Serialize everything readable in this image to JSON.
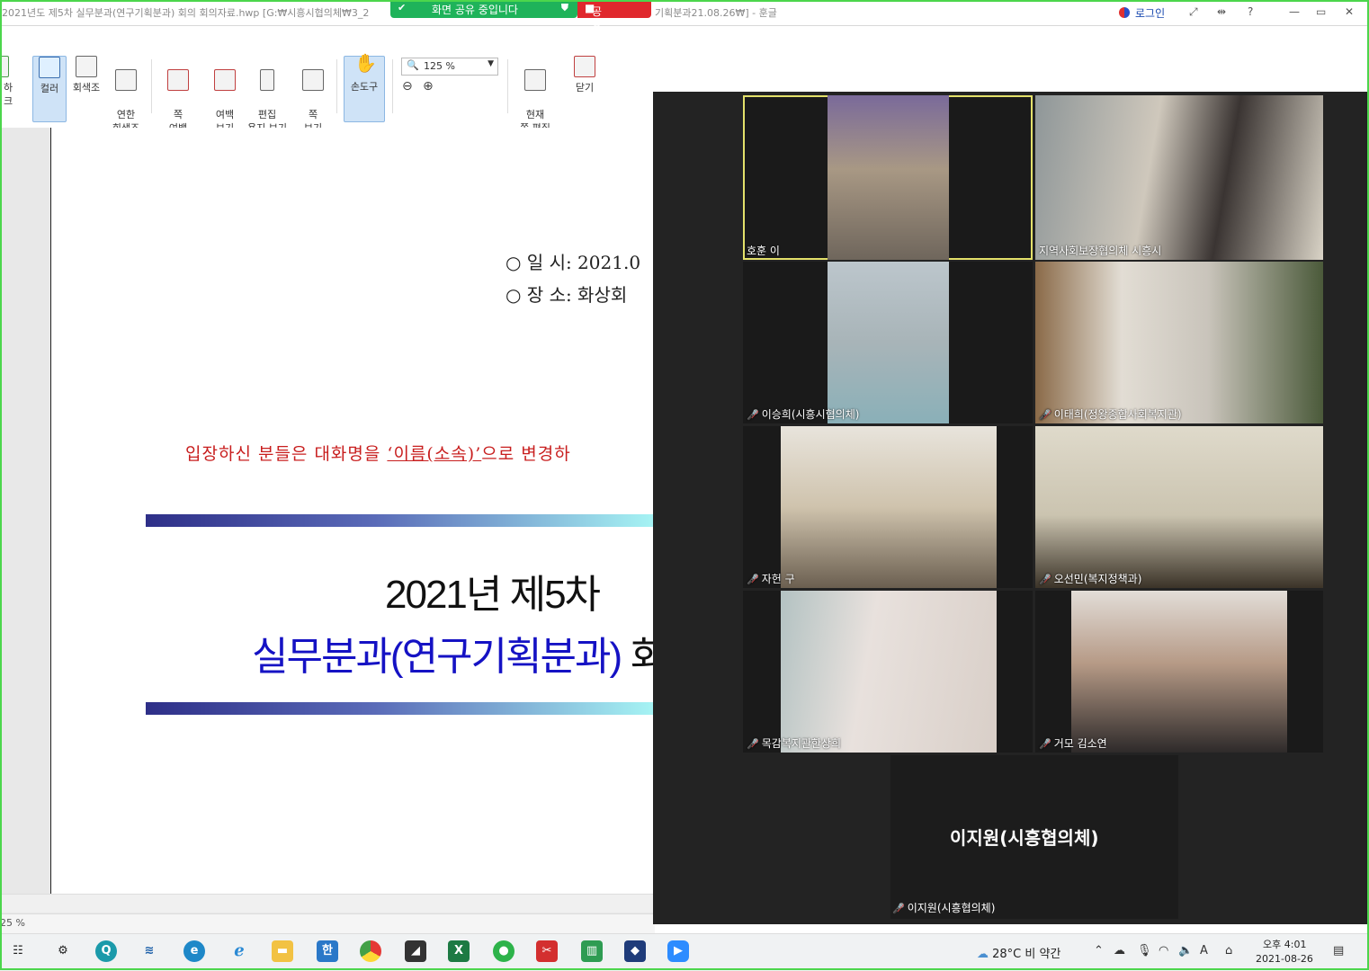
{
  "window": {
    "title": "2021년도 제5차 실무분과(연구기획분과) 회의 회의자료.hwp [G:₩시흥시협의체₩3_2",
    "title_tail": "기획분과21.08.26₩] - 훈글",
    "login_label": "로그인",
    "controls": [
      "⤢",
      "⇹",
      "?",
      "—",
      "▭",
      "✕"
    ]
  },
  "share_bar": {
    "status": "화면 공유 중입니다",
    "stop_label": "공유 중지",
    "color": "#1fb35a",
    "stop_color": "#e0282d"
  },
  "toolbar": {
    "cut_label": "하크",
    "color_label": "컬러",
    "grayscale_label": "회색조",
    "light_gray_label": "연한\n회색조",
    "page_margin_label": "쪽\n여백",
    "margin_view_label": "여백\n보기",
    "edit_paper_label": "편집\n용지 보기",
    "page_view_label": "쪽\n보기",
    "hand_tool_label": "손도구",
    "zoom_value": "125 %",
    "current_page_edit_label": "현재\n쪽 편집",
    "close_label": "닫기"
  },
  "document": {
    "date_line": "○  일  시:  2021.0",
    "place_line": "○  장  소:  화상회",
    "notice_prefix": "입장하신 분들은 대화명을 ",
    "notice_underlined": "‘이름(소속)’",
    "notice_suffix": "으로 변경하",
    "title_line1": "2021년  제5차",
    "title_line2_blue": "실무분과(연구기획분과) ",
    "title_line2_black": "회",
    "zoom_status": "25 %"
  },
  "meeting": {
    "participants": [
      {
        "name": "호훈 이",
        "muted": false,
        "active_speaker": true
      },
      {
        "name": "지역사회보장협의체 시흥시",
        "muted": false,
        "active_speaker": false
      },
      {
        "name": "이승희(시흥시협의체)",
        "muted": true,
        "active_speaker": false
      },
      {
        "name": "이태희(정왕종합사회복지관)",
        "muted": true,
        "active_speaker": false
      },
      {
        "name": "자헌 구",
        "muted": true,
        "active_speaker": false
      },
      {
        "name": "오선민(복지정책과)",
        "muted": true,
        "active_speaker": false
      },
      {
        "name": "목감복지관한상희",
        "muted": true,
        "active_speaker": false
      },
      {
        "name": "거모 김소연",
        "muted": true,
        "active_speaker": false
      }
    ],
    "no_video_display_name": "이지원(시흥협의체)",
    "no_video_label": "이지원(시흥협의체)"
  },
  "taskbar": {
    "weather": "28°C  비 약간",
    "time": "오후 4:01",
    "date": "2021-08-26",
    "apps": [
      "start-icon",
      "settings-icon",
      "search-app-icon",
      "scanner-icon",
      "edge-icon",
      "ie-icon",
      "explorer-icon",
      "hangul-icon",
      "chrome-icon",
      "sticky-notes-icon",
      "excel-icon",
      "greenapp-icon",
      "pdf-icon",
      "chart-app-icon",
      "paint-icon",
      "zoom-icon"
    ]
  }
}
